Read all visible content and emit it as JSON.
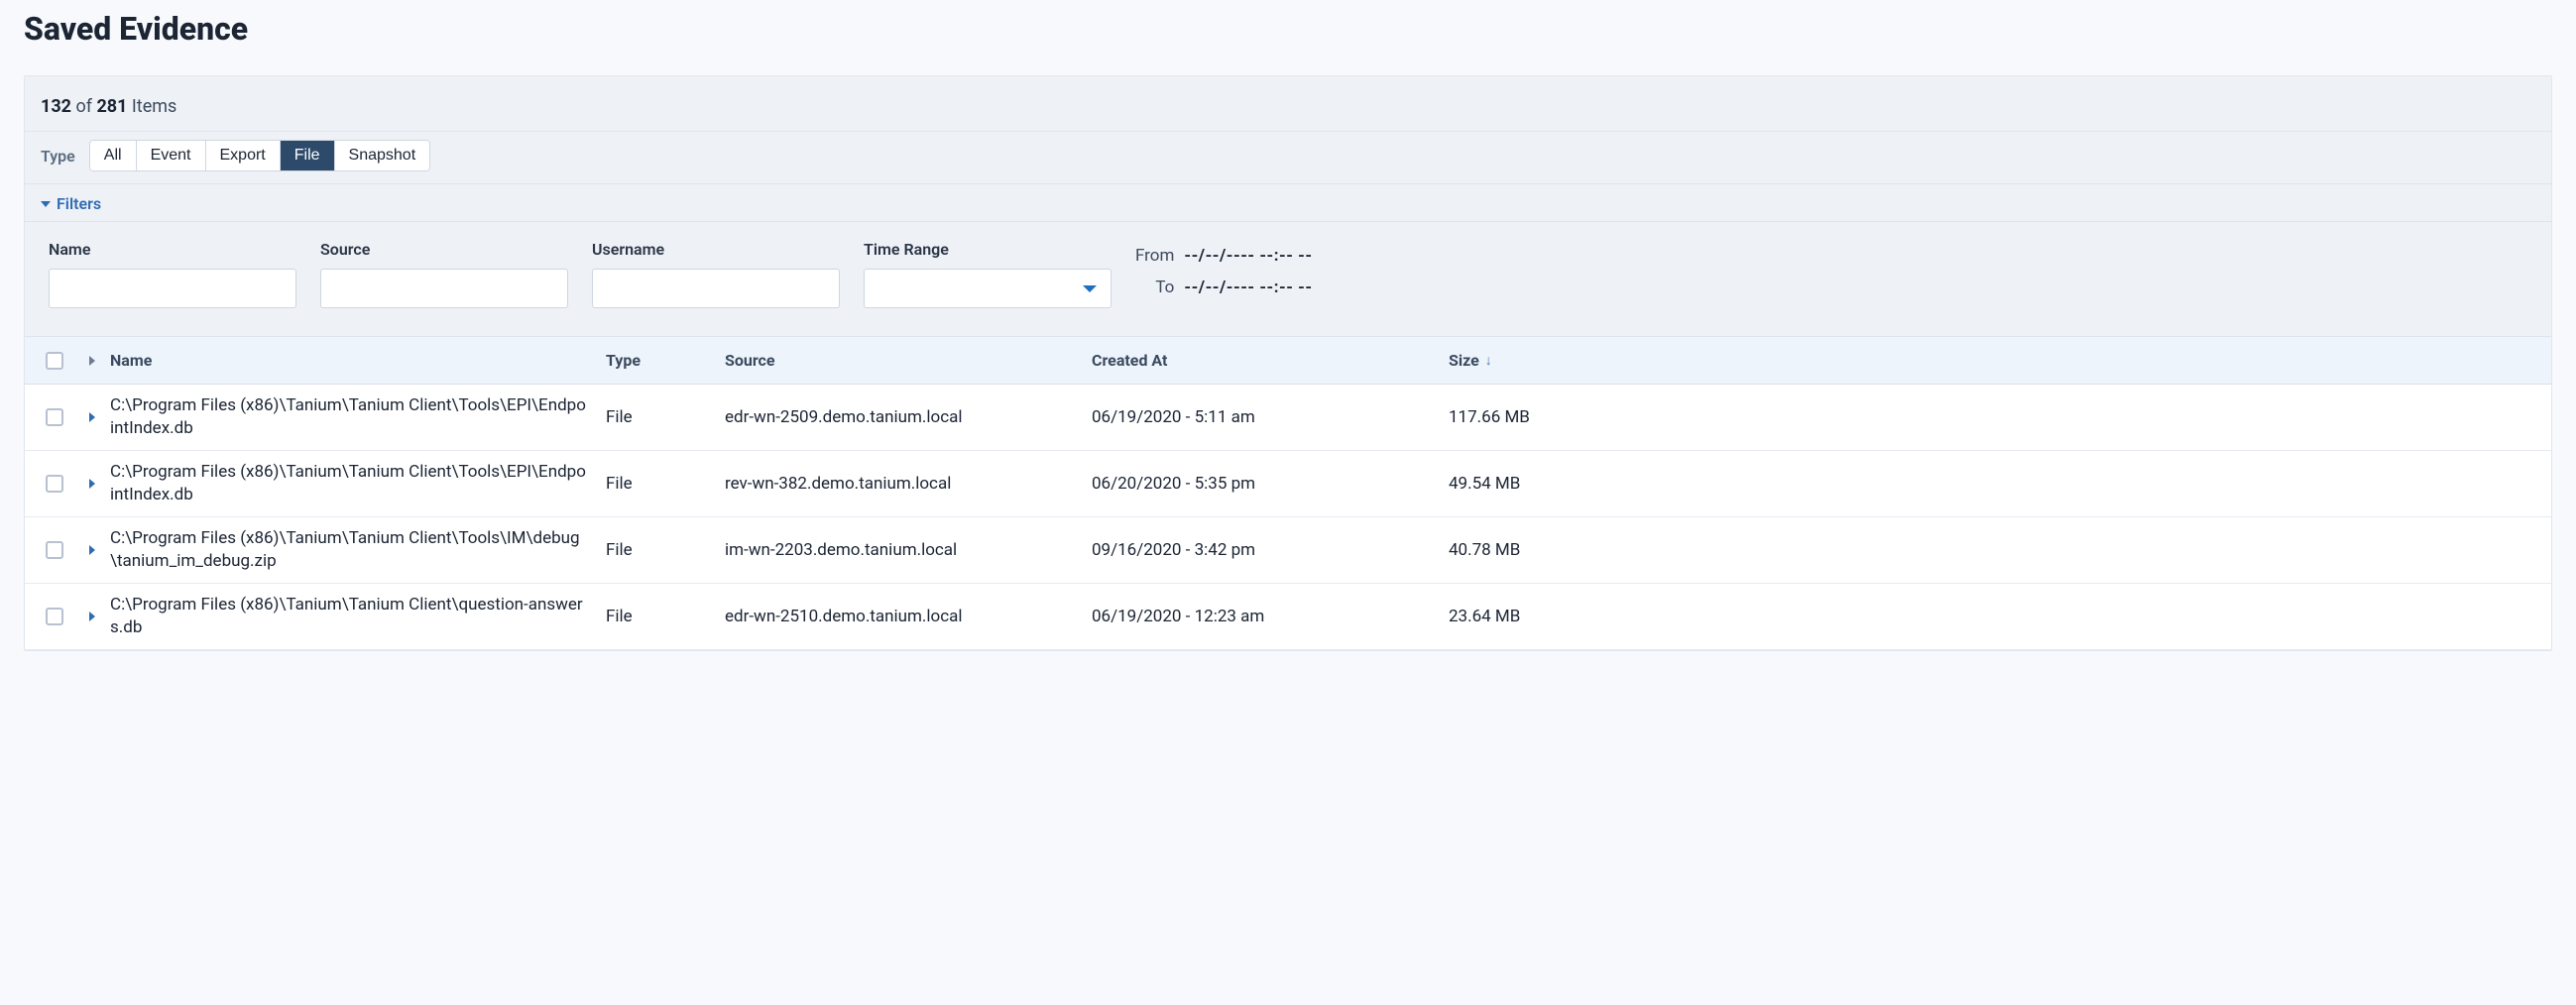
{
  "title": "Saved Evidence",
  "count": {
    "shown": "132",
    "of_word": "of",
    "total": "281",
    "items_word": "Items"
  },
  "type_filter": {
    "label": "Type",
    "options": [
      "All",
      "Event",
      "Export",
      "File",
      "Snapshot"
    ],
    "active": "File"
  },
  "filters": {
    "toggle_label": "Filters",
    "name_label": "Name",
    "source_label": "Source",
    "username_label": "Username",
    "timerange_label": "Time Range",
    "from_label": "From",
    "to_label": "To",
    "from_value": "--/--/---- --:-- --",
    "to_value": "--/--/---- --:-- --"
  },
  "columns": {
    "name": "Name",
    "type": "Type",
    "source": "Source",
    "created": "Created At",
    "size": "Size"
  },
  "rows": [
    {
      "name": "C:\\Program Files (x86)\\Tanium\\Tanium Client\\Tools\\EPI\\EndpointIndex.db",
      "type": "File",
      "source": "edr-wn-2509.demo.tanium.local",
      "created": "06/19/2020 - 5:11 am",
      "size": "117.66 MB"
    },
    {
      "name": "C:\\Program Files (x86)\\Tanium\\Tanium Client\\Tools\\EPI\\EndpointIndex.db",
      "type": "File",
      "source": "rev-wn-382.demo.tanium.local",
      "created": "06/20/2020 - 5:35 pm",
      "size": "49.54 MB"
    },
    {
      "name": "C:\\Program Files (x86)\\Tanium\\Tanium Client\\Tools\\IM\\debug\\tanium_im_debug.zip",
      "type": "File",
      "source": "im-wn-2203.demo.tanium.local",
      "created": "09/16/2020 - 3:42 pm",
      "size": "40.78 MB"
    },
    {
      "name": "C:\\Program Files (x86)\\Tanium\\Tanium Client\\question-answers.db",
      "type": "File",
      "source": "edr-wn-2510.demo.tanium.local",
      "created": "06/19/2020 - 12:23 am",
      "size": "23.64 MB"
    }
  ]
}
